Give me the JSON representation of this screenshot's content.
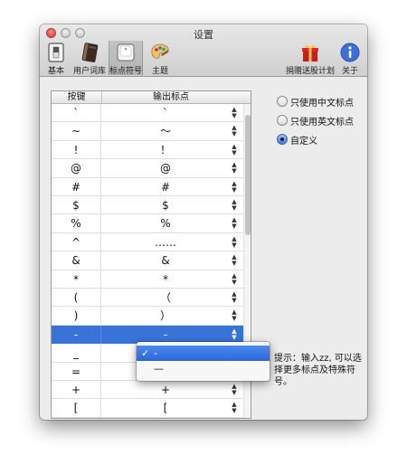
{
  "window": {
    "title": "设置"
  },
  "toolbar": {
    "items": [
      {
        "label": "基本",
        "icon": "switch-icon"
      },
      {
        "label": "用户词库",
        "icon": "notebook-icon"
      },
      {
        "label": "标点符号",
        "icon": "keyboard-key-icon",
        "selected": true
      },
      {
        "label": "主题",
        "icon": "palette-icon"
      },
      {
        "label": "捐赠送股计划",
        "icon": "gift-icon"
      },
      {
        "label": "关于",
        "icon": "info-icon"
      }
    ]
  },
  "table": {
    "headers": {
      "key": "按键",
      "output": "输出标点"
    },
    "rows": [
      {
        "key": "`",
        "output": "`"
      },
      {
        "key": "~",
        "output": "～"
      },
      {
        "key": "!",
        "output": "！"
      },
      {
        "key": "@",
        "output": "@"
      },
      {
        "key": "#",
        "output": "#"
      },
      {
        "key": "$",
        "output": "$"
      },
      {
        "key": "%",
        "output": "%"
      },
      {
        "key": "^",
        "output": "……"
      },
      {
        "key": "&",
        "output": "&"
      },
      {
        "key": "*",
        "output": "*"
      },
      {
        "key": "(",
        "output": "（"
      },
      {
        "key": ")",
        "output": "）"
      },
      {
        "key": "-",
        "output": "-",
        "selected": true
      },
      {
        "key": "_",
        "output": ""
      },
      {
        "key": "=",
        "output": ""
      },
      {
        "key": "+",
        "output": "+"
      },
      {
        "key": "[",
        "output": "["
      }
    ],
    "stepper_glyph": "▲▼"
  },
  "popup": {
    "items": [
      {
        "label": "-",
        "checked": true
      },
      {
        "label": "—",
        "checked": false
      }
    ],
    "check_glyph": "✓"
  },
  "options": {
    "radios": [
      {
        "label": "只使用中文标点",
        "checked": false
      },
      {
        "label": "只使用英文标点",
        "checked": false
      },
      {
        "label": "自定义",
        "checked": true
      }
    ]
  },
  "hint": {
    "text": "提示：输入zz, 可以选择更多标点及特殊符号。"
  },
  "colors": {
    "selection": "#3874d8",
    "menu_highlight": "#2f6ddc",
    "close_button": "#e0443e"
  }
}
